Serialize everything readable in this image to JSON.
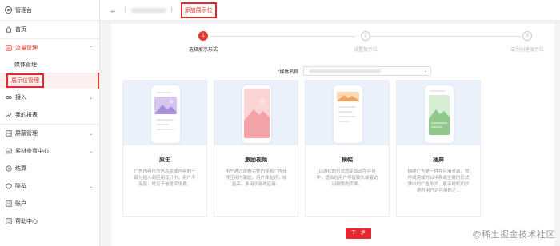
{
  "sidebar": {
    "brand": "管理台",
    "items": [
      {
        "label": "首页",
        "icon": "home-icon"
      },
      {
        "label": "流量管理",
        "icon": "traffic-icon",
        "expanded": true
      },
      {
        "label": "媒体管理",
        "sub": true
      },
      {
        "label": "展示位管理",
        "sub": true,
        "active": true
      },
      {
        "label": "接入",
        "icon": "link-icon"
      },
      {
        "label": "我的报表",
        "icon": "report-icon"
      },
      {
        "label": "屏蔽管理",
        "icon": "block-icon"
      },
      {
        "label": "素材查看中心",
        "icon": "image-icon"
      },
      {
        "label": "结算",
        "icon": "money-icon"
      },
      {
        "label": "隐私",
        "icon": "privacy-icon"
      },
      {
        "label": "账户",
        "icon": "account-icon"
      },
      {
        "label": "帮助中心",
        "icon": "help-icon"
      }
    ]
  },
  "topbar": {
    "back": "←",
    "separator": "|",
    "current": "添加展示位"
  },
  "steps": [
    {
      "num": "1",
      "label": "选择展示形式",
      "state": "done"
    },
    {
      "num": "2",
      "label": "设置展示位",
      "state": "pending"
    },
    {
      "num": "3",
      "label": "成功创建展示位",
      "state": "pending"
    }
  ],
  "media_field": {
    "required_mark": "*",
    "label": "媒体名称"
  },
  "cards": [
    {
      "title": "原生",
      "desc": "广告内容作为信息流或内容的一部分插入到应用设计中，用户不反感，常见于信息流场景。"
    },
    {
      "title": "激励视频",
      "desc": "用户通过观看完整的视频广告获得应用内激励，用户体验好，收益高，多用于游戏应用。"
    },
    {
      "title": "横幅",
      "desc": "以通栏的形式固定出现在应用中，适合在用户停留较久或者访问频繁的页面。"
    },
    {
      "title": "插屏",
      "desc": "插屏广告是一种在应用开启、暂停或完成时以半屏或全屏的形式弹出的广告形式，展示时机巧妙避开用户对应用的正..."
    }
  ],
  "colors": {
    "accent": "#e33a2f",
    "highlight_box": "#e8262b",
    "preview_bg": "#eaf1fb"
  },
  "next_button": "下一步",
  "watermark": "@稀土掘金技术社区"
}
